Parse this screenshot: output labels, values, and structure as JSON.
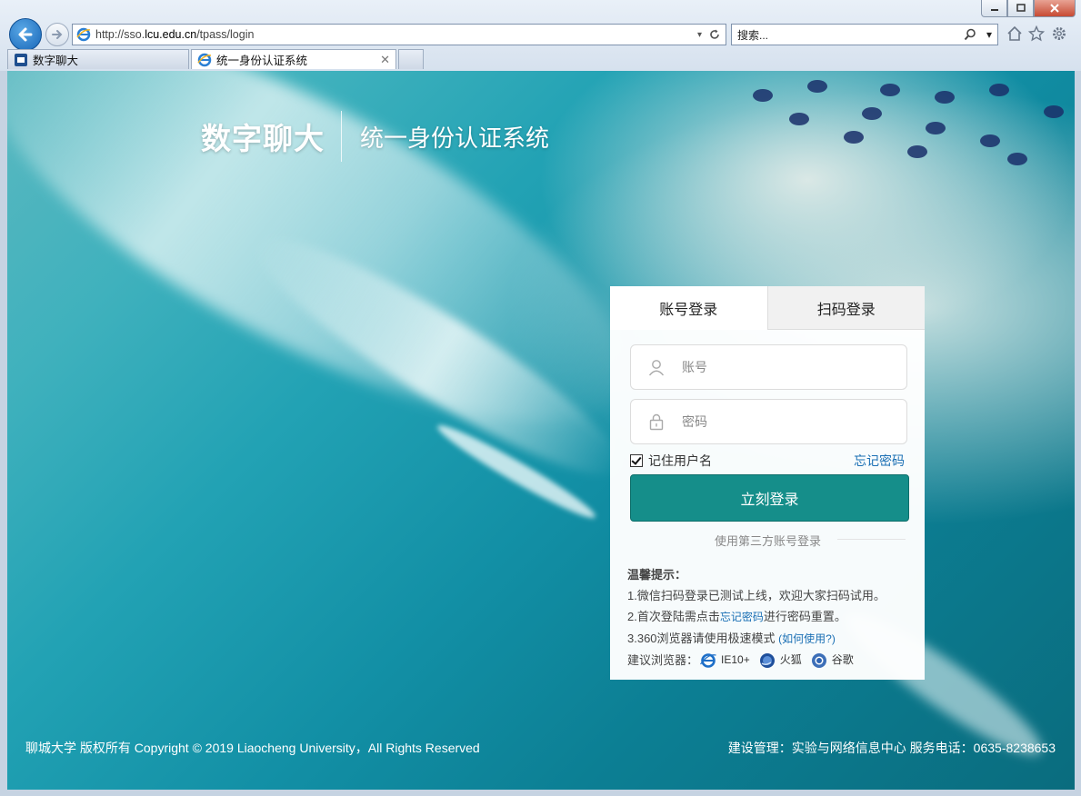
{
  "browser": {
    "url_prefix": "http://sso.",
    "url_host": "lcu.edu.cn",
    "url_path": "/tpass/login",
    "search_placeholder": "搜索...",
    "tabs": [
      {
        "label": "数字聊大"
      },
      {
        "label": "统一身份认证系统"
      }
    ]
  },
  "header": {
    "brand": "数字聊大",
    "system_name": "统一身份认证系统"
  },
  "login": {
    "tab_account": "账号登录",
    "tab_qrcode": "扫码登录",
    "username_placeholder": "账号",
    "password_placeholder": "密码",
    "remember_label": "记住用户名",
    "forgot_label": "忘记密码",
    "submit_label": "立刻登录",
    "third_party_label": "使用第三方账号登录"
  },
  "tips": {
    "title": "温馨提示：",
    "line1": "1.微信扫码登录已测试上线，欢迎大家扫码试用。",
    "line2_prefix": "2.首次登陆需点击",
    "line2_link": "忘记密码",
    "line2_suffix": "进行密码重置。",
    "line3_prefix": "3.360浏览器请使用极速模式",
    "line3_link": "(如何使用?)",
    "browsers_label": "建议浏览器：",
    "browsers": [
      "IE10+",
      "火狐",
      "谷歌"
    ]
  },
  "footer": {
    "copyright": "聊城大学 版权所有 Copyright © 2019 Liaocheng University，All Rights Reserved",
    "manage": "建设管理：实验与网络信息中心 服务电话：0635-8238653"
  },
  "colors": {
    "primary_button": "#158e8a",
    "link": "#1a6fb4"
  }
}
